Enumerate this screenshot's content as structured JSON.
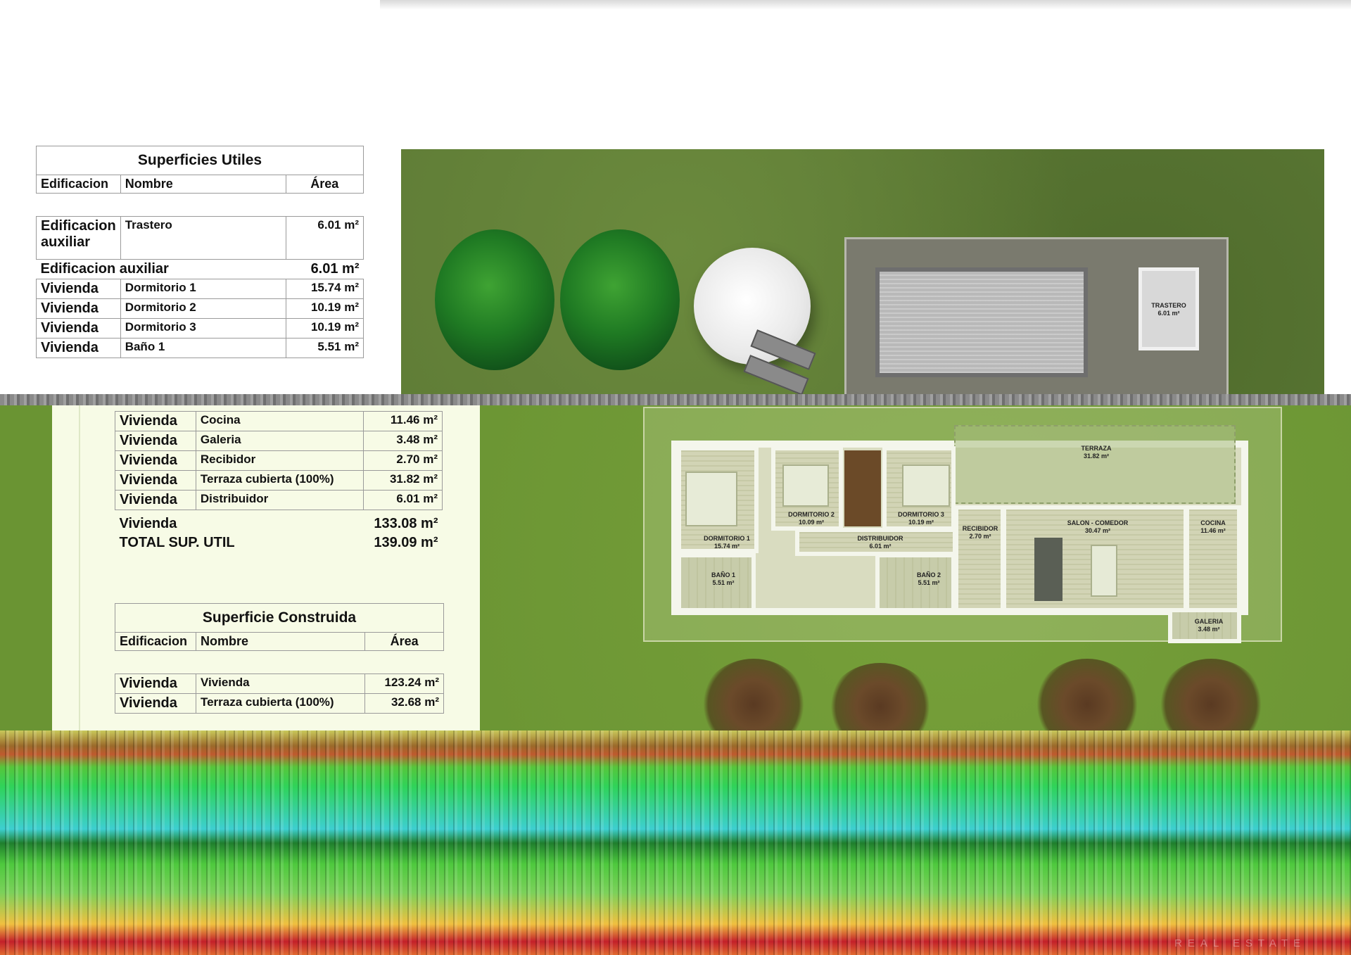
{
  "table_utiles": {
    "title": "Superficies Utiles",
    "headers": {
      "edificacion": "Edificacion",
      "nombre": "Nombre",
      "area": "Área"
    },
    "row_trastero": {
      "edificacion": "Edificacion auxiliar",
      "nombre": "Trastero",
      "area": "6.01 m²"
    },
    "subtotal_auxiliar": {
      "label": "Edificacion auxiliar",
      "area": "6.01 m²"
    },
    "rows_top": [
      {
        "edificacion": "Vivienda",
        "nombre": "Dormitorio 1",
        "area": "15.74 m²"
      },
      {
        "edificacion": "Vivienda",
        "nombre": "Dormitorio 2",
        "area": "10.19 m²"
      },
      {
        "edificacion": "Vivienda",
        "nombre": "Dormitorio 3",
        "area": "10.19 m²"
      },
      {
        "edificacion": "Vivienda",
        "nombre": "Baño 1",
        "area": "5.51 m²"
      }
    ],
    "rows_bottom": [
      {
        "edificacion": "Vivienda",
        "nombre": "Cocina",
        "area": "11.46 m²"
      },
      {
        "edificacion": "Vivienda",
        "nombre": "Galeria",
        "area": "3.48 m²"
      },
      {
        "edificacion": "Vivienda",
        "nombre": "Recibidor",
        "area": "2.70 m²"
      },
      {
        "edificacion": "Vivienda",
        "nombre": "Terraza cubierta (100%)",
        "area": "31.82 m²"
      },
      {
        "edificacion": "Vivienda",
        "nombre": "Distribuidor",
        "area": "6.01 m²"
      }
    ],
    "subtotal_vivienda": {
      "label": "Vivienda",
      "area": "133.08 m²"
    },
    "total": {
      "label": "TOTAL SUP. UTIL",
      "area": "139.09 m²"
    }
  },
  "table_construida": {
    "title": "Superficie Construida",
    "headers": {
      "edificacion": "Edificacion",
      "nombre": "Nombre",
      "area": "Área"
    },
    "rows": [
      {
        "edificacion": "Vivienda",
        "nombre": "Vivienda",
        "area": "123.24 m²"
      },
      {
        "edificacion": "Vivienda",
        "nombre": "Terraza cubierta (100%)",
        "area": "32.68 m²"
      }
    ]
  },
  "plan_labels": {
    "trastero": {
      "name": "TRASTERO",
      "area": "6.01 m²"
    },
    "terraza": {
      "name": "TERRAZA",
      "area": "31.82 m²"
    },
    "dormitorio1": {
      "name": "DORMITORIO 1",
      "area": "15.74 m²"
    },
    "dormitorio2": {
      "name": "DORMITORIO 2",
      "area": "10.09 m²"
    },
    "dormitorio3": {
      "name": "DORMITORIO 3",
      "area": "10.19 m²"
    },
    "distribuidor": {
      "name": "DISTRIBUIDOR",
      "area": "6.01 m²"
    },
    "recibidor": {
      "name": "RECIBIDOR",
      "area": "2.70 m²"
    },
    "salon": {
      "name": "SALON - COMEDOR",
      "area": "30.47 m²"
    },
    "cocina": {
      "name": "COCINA",
      "area": "11.46 m²"
    },
    "bano1": {
      "name": "BAÑO 1",
      "area": "5.51 m²"
    },
    "bano2": {
      "name": "BAÑO 2",
      "area": "5.51 m²"
    },
    "galeria": {
      "name": "GALERIA",
      "area": "3.48 m²"
    }
  },
  "watermark": "REAL ESTATE",
  "colors": {
    "grass_top": "#5d7a35",
    "grass_mid": "#6a9433",
    "panel_bg": "#f7fbe6"
  }
}
